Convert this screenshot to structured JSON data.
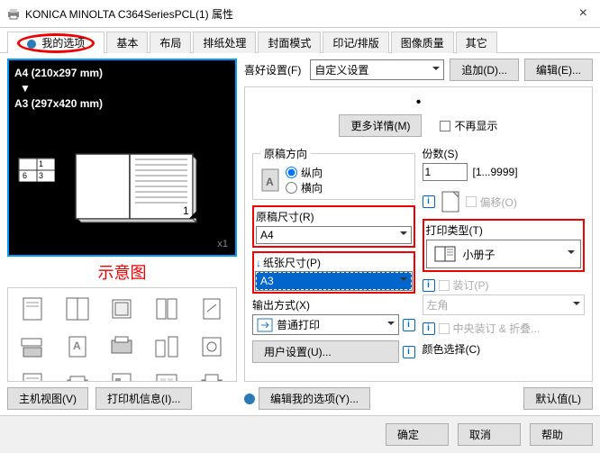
{
  "window": {
    "title": "KONICA MINOLTA C364SeriesPCL(1) 属性",
    "close": "×"
  },
  "tabs": {
    "my_options": "我的选项",
    "basic": "基本",
    "layout": "布局",
    "paper": "排纸处理",
    "cover": "封面模式",
    "stamp": "印记/排版",
    "quality": "图像质量",
    "other": "其它"
  },
  "preview": {
    "line1": "A4 (210x297 mm)",
    "arrow": "▼",
    "line2": "A3 (297x420 mm)",
    "x1": "x1",
    "t1": "1",
    "t2": "6",
    "t3": "3",
    "pg": "1",
    "corner": "◢"
  },
  "caption": "示意图",
  "left_buttons": {
    "host": "主机视图(V)",
    "info": "打印机信息(I)..."
  },
  "fav": {
    "label": "喜好设置(F)",
    "value": "自定义设置",
    "add": "追加(D)...",
    "edit": "编辑(E)..."
  },
  "more": {
    "button": "更多详情(M)",
    "noshow": "不再显示"
  },
  "orientation": {
    "legend": "原稿方向",
    "portrait": "纵向",
    "landscape": "横向"
  },
  "copies": {
    "label": "份数(S)",
    "value": "1",
    "range": "[1...9999]"
  },
  "orig_size": {
    "label": "原稿尺寸(R)",
    "value": "A4"
  },
  "paper_size": {
    "label": "纸张尺寸(P)",
    "value": "A3"
  },
  "offset": {
    "label": "偏移(O)"
  },
  "print_type": {
    "label": "打印类型(T)",
    "value": "小册子"
  },
  "output": {
    "label": "输出方式(X)",
    "value": "普通打印"
  },
  "binding": {
    "label": "装订(P)",
    "value": "左角",
    "fold": "中央装订 & 折叠..."
  },
  "user_settings": {
    "label": "用户设置(U)..."
  },
  "color": {
    "label": "颜色选择(C)"
  },
  "edit_options": "编辑我的选项(Y)...",
  "default": "默认值(L)",
  "dialog": {
    "ok": "确定",
    "cancel": "取消",
    "help": "帮助"
  },
  "icons": {
    "bullet": "•",
    "info": "i",
    "down": "↓"
  }
}
